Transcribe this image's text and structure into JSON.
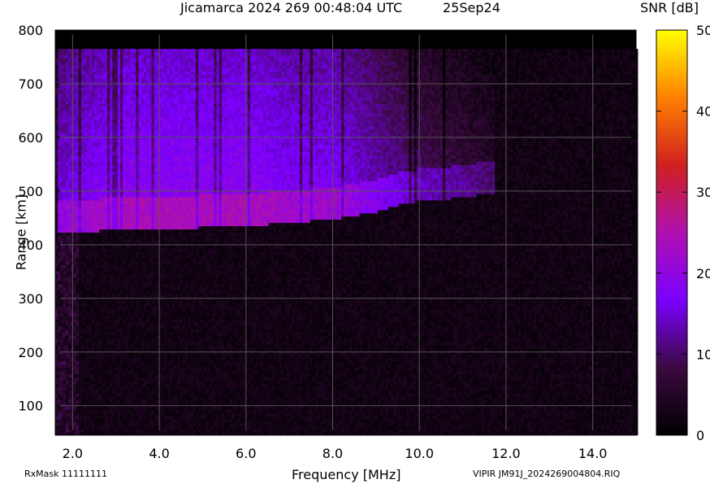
{
  "header": {
    "title": "Jicamarca 2024 269 00:48:04 UTC",
    "date": "25Sep24"
  },
  "footer": {
    "rxmask": "RxMask 11111111",
    "file": "VIPIR  JM91J_2024269004804.RIQ"
  },
  "colorbar": {
    "label": "SNR [dB]",
    "ticks": [
      0,
      10,
      20,
      30,
      40,
      50
    ],
    "min": 0,
    "max": 50,
    "colors": [
      "#000000",
      "#3a0a40",
      "#7a00ff",
      "#b010b0",
      "#d02020",
      "#ff8000",
      "#ffff00"
    ]
  },
  "chart_data": {
    "type": "heatmap",
    "title": "Jicamarca 2024 269 00:48:04 UTC",
    "xlabel": "Frequency [MHz]",
    "ylabel": "Range [km]",
    "xlim": [
      1.6,
      15.0
    ],
    "ylim": [
      45,
      800
    ],
    "x_ticks": [
      "2.0",
      "4.0",
      "6.0",
      "8.0",
      "10.0",
      "12.0",
      "14.0"
    ],
    "y_ticks": [
      100,
      200,
      300,
      400,
      500,
      600,
      700,
      800
    ],
    "grid": true,
    "colorbar_label": "SNR [dB]",
    "colorbar_range": [
      0,
      50
    ],
    "data_top_range_km": 765,
    "echo_trace": [
      {
        "freq_mhz": 1.6,
        "virtual_height_km": 418,
        "snr_db": 20
      },
      {
        "freq_mhz": 3.0,
        "virtual_height_km": 425,
        "snr_db": 24
      },
      {
        "freq_mhz": 4.5,
        "virtual_height_km": 428,
        "snr_db": 24
      },
      {
        "freq_mhz": 6.0,
        "virtual_height_km": 432,
        "snr_db": 24
      },
      {
        "freq_mhz": 7.0,
        "virtual_height_km": 438,
        "snr_db": 22
      },
      {
        "freq_mhz": 8.0,
        "virtual_height_km": 445,
        "snr_db": 22
      },
      {
        "freq_mhz": 9.0,
        "virtual_height_km": 458,
        "snr_db": 18
      },
      {
        "freq_mhz": 9.5,
        "virtual_height_km": 472,
        "snr_db": 16
      },
      {
        "freq_mhz": 10.0,
        "virtual_height_km": 478,
        "snr_db": 14
      },
      {
        "freq_mhz": 11.0,
        "virtual_height_km": 485,
        "snr_db": 12
      },
      {
        "freq_mhz": 11.7,
        "virtual_height_km": 495,
        "snr_db": 10
      }
    ]
  }
}
